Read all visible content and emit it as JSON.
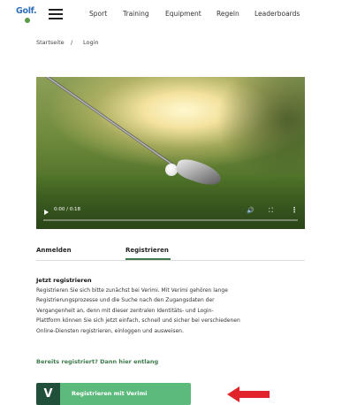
{
  "header": {
    "logo_text": "Golf.",
    "nav": [
      "Sport",
      "Training",
      "Equipment",
      "Regeln",
      "Leaderboards"
    ]
  },
  "breadcrumb": {
    "home": "Startseite",
    "separator": "/",
    "current": "Login"
  },
  "video": {
    "time": "0:00 / 0:18",
    "progress": 0
  },
  "tabs": {
    "login": "Anmelden",
    "register": "Registrieren",
    "active": "register"
  },
  "content": {
    "title": "Jetzt registrieren",
    "lines": [
      "Registrieren Sie sich bitte zunächst bei Verimi. Mit Verimi gehören lange",
      "Registrierungsprozesse und die Suche nach den Zugangsdaten der",
      "Vergangenheit an, denn mit dieser zentralen Identitäts- und Login-",
      "Plattform können Sie sich jetzt einfach, schnell und sicher bei verschiedenen",
      "Online-Diensten registrieren, einloggen und ausweisen."
    ],
    "already_link": "Bereits registriert? Dann hier entlang",
    "register_button": "Registrieren mit Verimi",
    "register_button_icon": "V"
  },
  "colors": {
    "accent_green": "#3c7a4b",
    "button_green": "#5dba7d",
    "button_icon_bg": "#20503a",
    "arrow_red": "#e0242a",
    "logo_blue": "#2f6fb7"
  }
}
